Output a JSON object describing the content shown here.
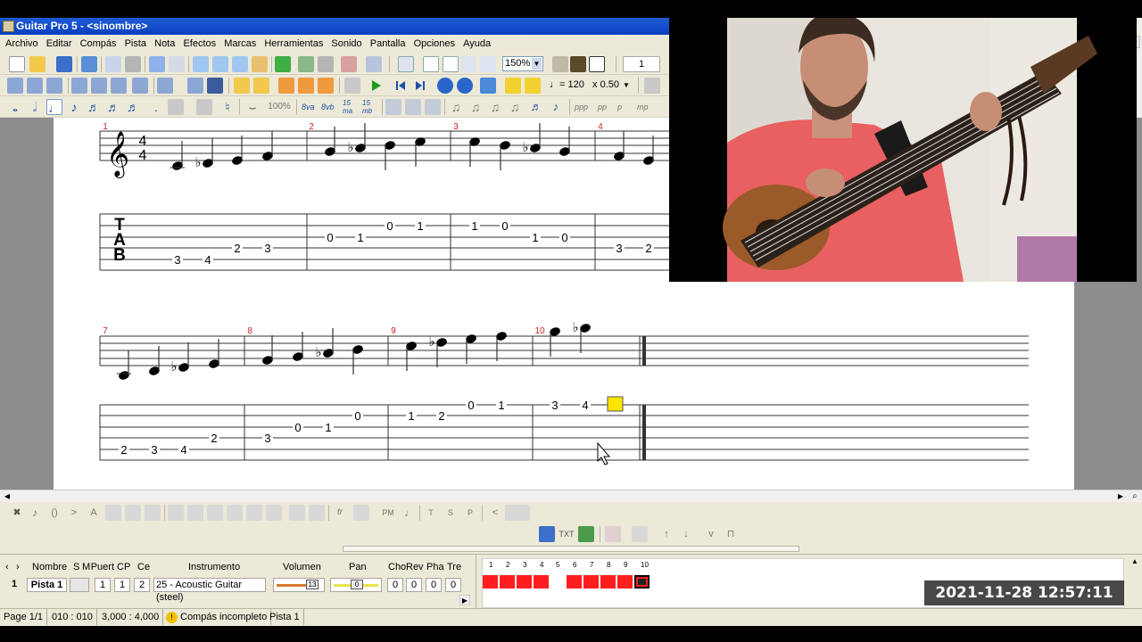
{
  "window": {
    "title": "Guitar Pro 5 - <sinombre>"
  },
  "menu": [
    "Archivo",
    "Editar",
    "Compás",
    "Pista",
    "Nota",
    "Efectos",
    "Marcas",
    "Herramientas",
    "Sonido",
    "Pantalla",
    "Opciones",
    "Ayuda"
  ],
  "toolbar": {
    "zoom": "150%",
    "page_number": "1",
    "tempo": "♩= 120",
    "speed": "x 0.50",
    "percent": "100%"
  },
  "score": {
    "tab_label": "TAB",
    "row1_measure_numbers": [
      "1",
      "2",
      "3",
      "4"
    ],
    "row2_measure_numbers": [
      "7",
      "8",
      "9",
      "10"
    ],
    "row1_frets": [
      "3",
      "4",
      "2",
      "3",
      "0",
      "1",
      "0",
      "1",
      "1",
      "0",
      "1",
      "0",
      "3",
      "2"
    ],
    "row2_frets": [
      "2",
      "3",
      "4",
      "2",
      "3",
      "0",
      "1",
      "0",
      "1",
      "2",
      "0",
      "1",
      "3",
      "4"
    ]
  },
  "effects_bar": {
    "pm_label": "PM",
    "t": "T",
    "s": "S",
    "p": "P"
  },
  "track_table": {
    "headers": [
      "Nombre",
      "S",
      "M",
      "Puert",
      "CP",
      "Ce",
      "Instrumento",
      "Volumen",
      "Pan",
      "Cho",
      "Rev",
      "Pha",
      "Tre"
    ],
    "row": {
      "index": "1",
      "name": "Pista 1",
      "port": "1",
      "channel": "1",
      "effects_channel": "2",
      "instrument": "25 - Acoustic Guitar (steel)",
      "volume": "13",
      "pan": "0",
      "cho": "0",
      "rev": "0",
      "pha": "0",
      "tre": "0"
    },
    "measure_numbers": [
      "1",
      "2",
      "3",
      "4",
      "5",
      "6",
      "7",
      "8",
      "9",
      "10"
    ]
  },
  "statusbar": {
    "page": "Page 1/1",
    "position": "010 : 010",
    "time": "3,000 : 4,000",
    "warning": "Compás incompleto",
    "track": "Pista 1"
  },
  "overlay": {
    "timestamp": "2021-11-28  12:57:11"
  },
  "colors": {
    "title_bar": "#0a3fbf",
    "measure_marker": "#ff1e1e",
    "cursor_yellow": "#ffe600",
    "measure_number": "#d02020"
  }
}
